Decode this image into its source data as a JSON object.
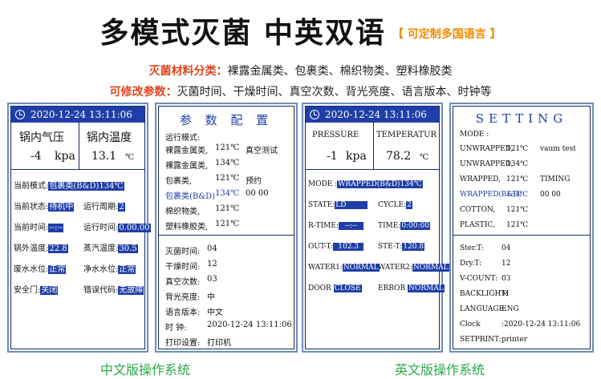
{
  "header": {
    "title": "多模式灭菌  中英双语",
    "tag": "【 可定制多国语言 】",
    "materials_label": "灭菌材料分类：",
    "materials_text": "裸露金属类、包裹类、棉织物类、塑料橡胶类",
    "params_label": "可修改参数：",
    "params_text": "灭菌时间、干燥时间、真空次数、背光亮度、语言版本、时钟等"
  },
  "p1": {
    "datetime": "2020-12-24   13:11:06",
    "pressure_label": "锅内气压",
    "temp_label": "锅内温度",
    "pressure_value": "-4",
    "pressure_unit": "kpa",
    "temp_value": "13.1",
    "temp_unit": "℃",
    "mode_label": "当前模式:",
    "mode_value": "包裹类(B&D)134℃",
    "state_label": "当前状态:",
    "state_value": "待机中",
    "cycle_label": "运行周期:",
    "cycle_value": "2",
    "time_label": "当前时间:",
    "time_value": "--:--",
    "run_label": "运行时间:",
    "run_value": "0.00.00",
    "ext_label": "锅外温度:",
    "ext_value": "22.8",
    "steam_label": "蒸汽温度:",
    "steam_value": "30.5",
    "waste_label": "废水水位:",
    "waste_value": "正常",
    "clean_label": "净水水位:",
    "clean_value": "正常",
    "door_label": "安全门:",
    "door_value": "关闭",
    "err_label": "错误代码:",
    "err_value": "无故障"
  },
  "p2": {
    "title": "参 数 配 置",
    "mode_label": "运行模式:",
    "rows": [
      {
        "name": "裸露金属类,",
        "temp": "121℃",
        "extra": "真空测试"
      },
      {
        "name": "裸露金属类,",
        "temp": "134℃",
        "extra": ""
      },
      {
        "name": "包裹类,",
        "temp": "121℃",
        "extra": "预约"
      },
      {
        "name": "包裹类(B&D)",
        "temp": "134℃",
        "extra": "00 00"
      },
      {
        "name": "棉织物类,",
        "temp": "121℃",
        "extra": ""
      },
      {
        "name": "塑料橡胶类,",
        "temp": "121℃",
        "extra": ""
      }
    ],
    "params": [
      {
        "label": "灭菌时间:",
        "value": "04"
      },
      {
        "label": "干燥时间:",
        "value": "12"
      },
      {
        "label": "真空次数:",
        "value": "03"
      },
      {
        "label": "背光亮度:",
        "value": "中"
      },
      {
        "label": "语言版本:",
        "value": "中文"
      },
      {
        "label": "时    钟:",
        "value": "2020-12-24   13:11:06"
      },
      {
        "label": "打印设置:",
        "value": "打印机"
      }
    ]
  },
  "p3": {
    "datetime": "2020-12-24   13:11:06",
    "pressure_label": "PRESSURE",
    "temp_label": "TEMPERATUR",
    "pressure_value": "-1",
    "pressure_unit": "kpa",
    "temp_value": "78.2",
    "temp_unit": "℃",
    "mode_label": "MODE :",
    "mode_value": "WRAPPED(B&D)134℃",
    "state_label": "STATE:",
    "state_value": "LD",
    "cycle_label": "CYCLE:",
    "cycle_value": "2",
    "rtime_label": "R-TIME:",
    "rtime_value": "--:--",
    "time_label": "TIME:",
    "time_value": "0:00:00",
    "out_label": "OUT-T:",
    "out_value": "102.3",
    "ste_label": "STE-T:",
    "ste_value": "120.8",
    "w1_label": "WATER1:",
    "w1_value": "NORMAL",
    "w2_label": "WATER2:",
    "w2_value": "NORMAL",
    "door_label": "DOOR",
    "door_value": "CLOSE",
    "err_label": "ERROR",
    "err_value": "NORMAL"
  },
  "p4": {
    "title": "SETTING",
    "mode_label": "MODE   :",
    "rows": [
      {
        "name": "UNWRAPPED,",
        "temp": "121℃",
        "extra": "vaum test"
      },
      {
        "name": "UNWRAPPED,",
        "temp": "134℃",
        "extra": ""
      },
      {
        "name": "WRAPPED,",
        "temp": "121℃",
        "extra": "TIMING"
      },
      {
        "name": "WRAPPED(B&D)",
        "temp": "134℃",
        "extra": "00 00"
      },
      {
        "name": "COTTON,",
        "temp": "121℃",
        "extra": ""
      },
      {
        "name": "PLASTIC,",
        "temp": "121℃",
        "extra": ""
      }
    ],
    "params": [
      {
        "label": "Ster.T:",
        "value": "04"
      },
      {
        "label": "Dry.T:",
        "value": "12"
      },
      {
        "label": "V-COUNT:",
        "value": "03"
      },
      {
        "label": "BACKLIGHT:",
        "value": "M"
      },
      {
        "label": "LANGUAGE:",
        "value": "ENG"
      },
      {
        "label": "Clock",
        "value": ":2020-12-24   13:11:06"
      },
      {
        "label": "SETPRINT:",
        "value": "printer"
      }
    ]
  },
  "captions": {
    "cn": "中文版操作系统",
    "en": "英文版操作系统"
  },
  "colors": {
    "accent": "#1f3fa8",
    "orange": "#f08a00",
    "red": "#e0451c",
    "green": "#2aa84a"
  }
}
